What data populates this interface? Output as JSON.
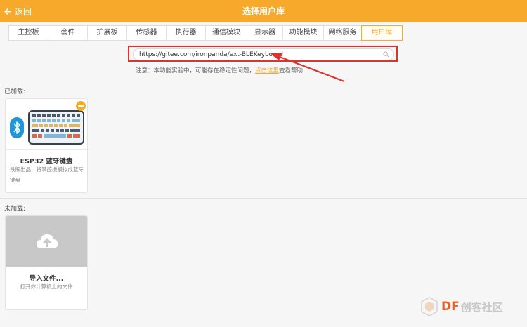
{
  "header": {
    "back_label": "返回",
    "title": "选择用户库"
  },
  "tabs": [
    {
      "label": "主控板",
      "active": false
    },
    {
      "label": "套件",
      "active": false
    },
    {
      "label": "扩展板",
      "active": false
    },
    {
      "label": "传感器",
      "active": false
    },
    {
      "label": "执行器",
      "active": false
    },
    {
      "label": "通信模块",
      "active": false
    },
    {
      "label": "显示器",
      "active": false
    },
    {
      "label": "功能模块",
      "active": false
    },
    {
      "label": "网络服务",
      "active": false
    },
    {
      "label": "用户库",
      "active": true
    }
  ],
  "search": {
    "value": "https://gitee.com/ironpanda/ext-BLEKeyboard"
  },
  "note": {
    "prefix": "注意：本功能实验中，可能存在稳定性问题，",
    "link": "点击这里",
    "suffix": "查看帮助"
  },
  "loaded": {
    "label": "已加载:",
    "card": {
      "title": "ESP32 蓝牙键盘",
      "desc_line1": "铁熊出品，将掌控板模拟成蓝牙",
      "desc_line2": "键盘"
    }
  },
  "unloaded": {
    "label": "未加载:",
    "card": {
      "title": "导入文件...",
      "desc": "打开你计算机上的文件"
    }
  },
  "watermark": {
    "text": "DF",
    "text2": "创客社区"
  },
  "colors": {
    "accent": "#f7a92b",
    "highlight": "#e0322d",
    "bluetooth": "#2196d6"
  }
}
